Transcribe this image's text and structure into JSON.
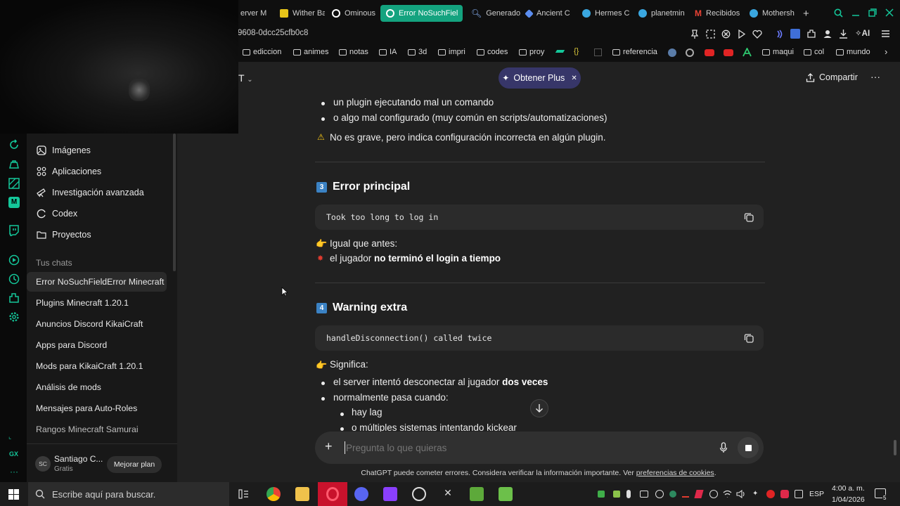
{
  "browser": {
    "tabs": [
      {
        "label": "erver M",
        "icon": "server-icon",
        "color": "#888888"
      },
      {
        "label": "Wither Ba",
        "icon": "wither-icon",
        "color": "#e6c419"
      },
      {
        "label": "Ominous",
        "icon": "chatgpt-icon",
        "color": "#ffffff"
      },
      {
        "label": "Error NoSuchFiel",
        "icon": "chatgpt-icon",
        "color": "#ffffff",
        "active": true
      },
      {
        "label": "Generado",
        "icon": "search-icon",
        "color": "#8ab4f8"
      },
      {
        "label": "Ancient C",
        "icon": "ancient-icon",
        "color": "#5b8def"
      },
      {
        "label": "Hermes C",
        "icon": "globe-icon",
        "color": "#3aa7e0"
      },
      {
        "label": "planetmin",
        "icon": "globe-icon",
        "color": "#3aa7e0"
      },
      {
        "label": "Recibidos",
        "icon": "gmail-icon",
        "color": "#ea4335"
      },
      {
        "label": "Mothersh",
        "icon": "globe-icon",
        "color": "#3aa7e0"
      }
    ],
    "url_fragment": "9608-0dcc25cfb0c8",
    "ai_label": "AI",
    "bookmarks": [
      "ediccion",
      "animes",
      "notas",
      "IA",
      "3d",
      "impri",
      "codes",
      "proy",
      "referencia",
      "maqui",
      "col",
      "mundo"
    ]
  },
  "sidebar": {
    "nav": [
      {
        "label": "Imágenes",
        "icon": "images-icon"
      },
      {
        "label": "Aplicaciones",
        "icon": "apps-icon"
      },
      {
        "label": "Investigación avanzada",
        "icon": "telescope-icon"
      },
      {
        "label": "Codex",
        "icon": "codex-icon"
      },
      {
        "label": "Proyectos",
        "icon": "folder-icon"
      }
    ],
    "chats_heading": "Tus chats",
    "chats": [
      "Error NoSuchFieldError Minecraft",
      "Plugins Minecraft 1.20.1",
      "Anuncios Discord KikaiCraft",
      "Apps para Discord",
      "Mods para KikaiCraft 1.20.1",
      "Análisis de mods",
      "Mensajes para Auto-Roles",
      "Rangos Minecraft Samurai"
    ],
    "user": {
      "initials": "SC",
      "name": "Santiago C...",
      "plan": "Gratis",
      "upgrade_label": "Mejorar plan"
    }
  },
  "header": {
    "model_suffix": "T",
    "plus_label": "Obtener Plus",
    "share_label": "Compartir"
  },
  "content": {
    "bullets_top": [
      "un plugin ejecutando mal un comando",
      "o algo mal configurado (muy común en scripts/automatizaciones)"
    ],
    "warning_note": "No es grave, pero indica configuración incorrecta en algún plugin.",
    "section3": {
      "num": "3",
      "title": "Error principal",
      "code": "Took too long to log in",
      "line1": "Igual que antes:",
      "line2_pre": "el jugador ",
      "line2_bold": "no terminó el login a tiempo"
    },
    "section4": {
      "num": "4",
      "title": "Warning extra",
      "code": "handleDisconnection() called twice",
      "meaning": "Significa:",
      "b1_pre": "el server intentó desconectar al jugador ",
      "b1_bold": "dos veces",
      "b2": "normalmente pasa cuando:",
      "sub1": "hay lag",
      "sub2": "o múltiples sistemas intentando kickear"
    }
  },
  "composer": {
    "placeholder": "Pregunta lo que quieras"
  },
  "disclaimer": {
    "text": "ChatGPT puede cometer errores. Considera verificar la información importante. Ver ",
    "link": "preferencias de cookies",
    "end": "."
  },
  "taskbar": {
    "search_placeholder": "Escribe aquí para buscar.",
    "lang": "ESP",
    "time": "4:00 a. m.",
    "date": "1/04/2026",
    "notif_count": "5"
  },
  "rail_labels": {
    "gx": "GX"
  }
}
